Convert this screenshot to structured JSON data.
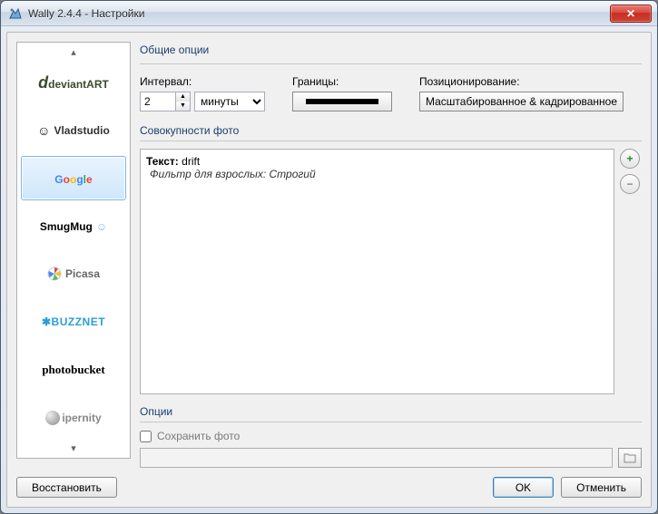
{
  "window": {
    "title": "Wally 2.4.4 - Настройки"
  },
  "sidebar": {
    "items": [
      {
        "label": "deviantART"
      },
      {
        "label": "Vladstudio"
      },
      {
        "label": "Google",
        "selected": true
      },
      {
        "label": "SmugMug"
      },
      {
        "label": "Picasa"
      },
      {
        "label": "BUZZNET"
      },
      {
        "label": "photobucket"
      },
      {
        "label": "ipernity"
      }
    ]
  },
  "general": {
    "heading": "Общие опции",
    "interval_label": "Интервал:",
    "interval_value": "2",
    "interval_unit": "минуты",
    "borders_label": "Границы:",
    "position_label": "Позиционирование:",
    "position_value": "Масштабированное & кадрированное"
  },
  "collections": {
    "heading": "Совокупности фото",
    "item_prefix": "Текст:",
    "item_value": "drift",
    "item_detail": "Фильтр для взрослых: Строгий"
  },
  "options": {
    "heading": "Опции",
    "save_label": "Сохранить фото",
    "save_checked": false,
    "path": ""
  },
  "footer": {
    "restore": "Восстановить",
    "ok": "OK",
    "cancel": "Отменить"
  }
}
